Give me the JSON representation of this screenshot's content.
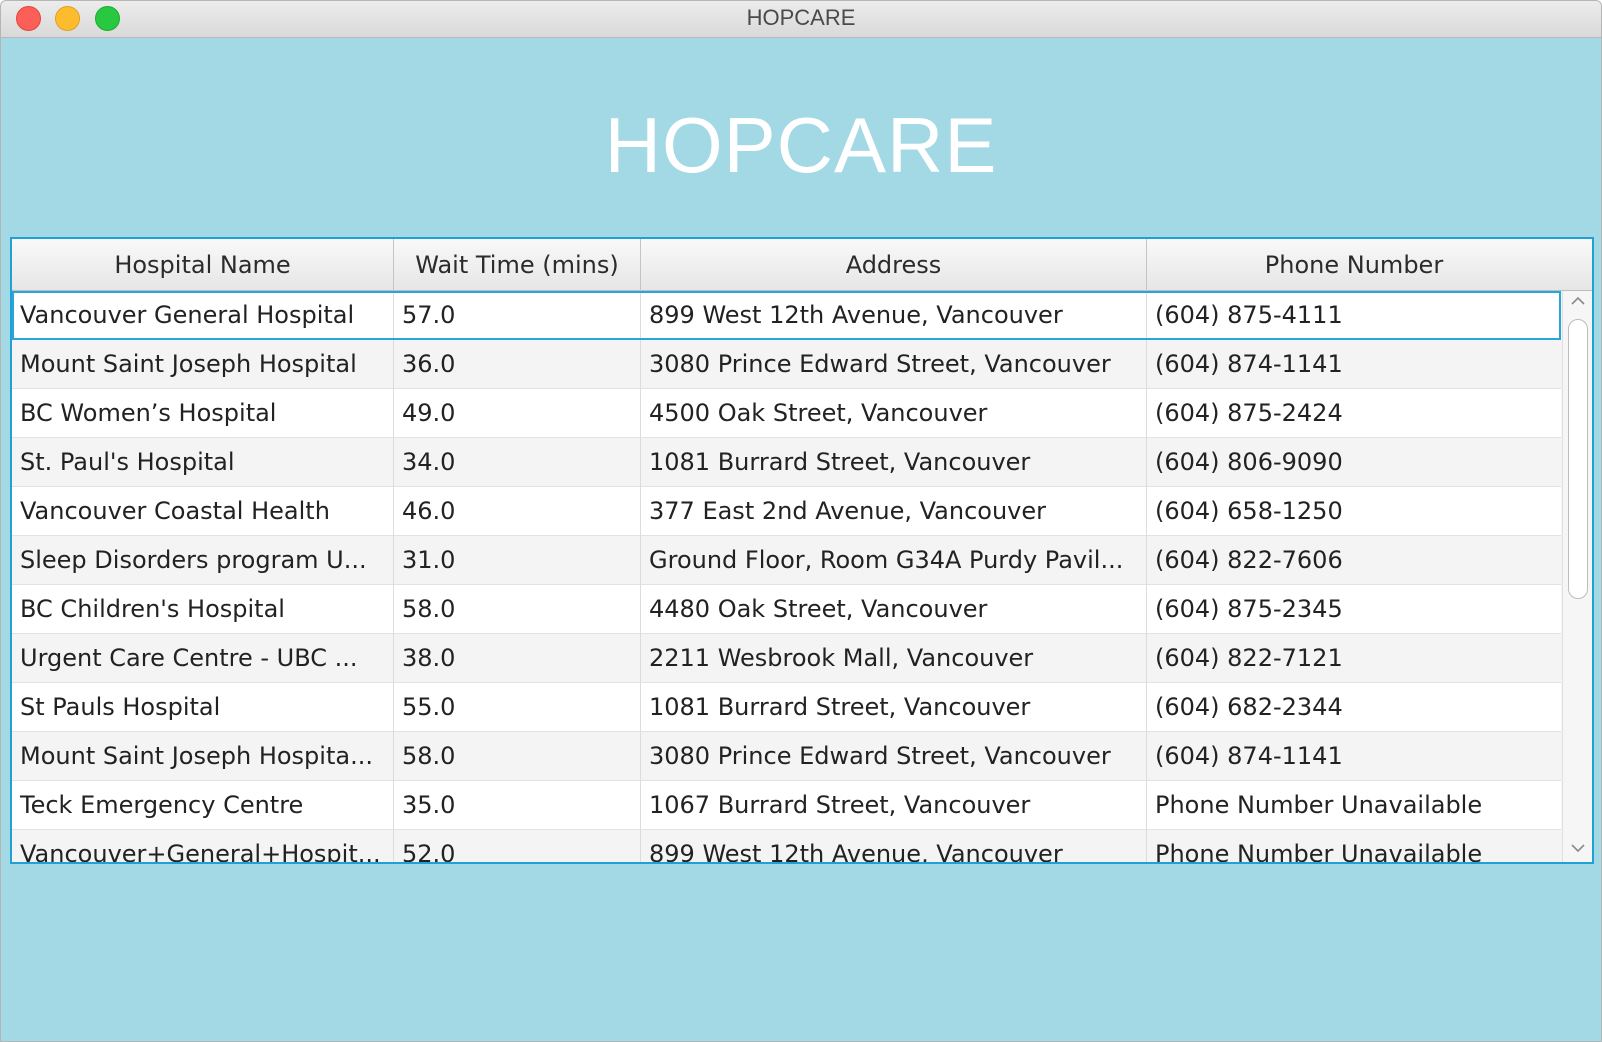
{
  "window": {
    "title": "HOPCARE"
  },
  "app": {
    "heading": "HOPCARE"
  },
  "table": {
    "columns": [
      "Hospital Name",
      "Wait Time (mins)",
      "Address",
      "Phone Number"
    ],
    "rows": [
      [
        "Vancouver General Hospital",
        "57.0",
        "899 West 12th Avenue, Vancouver",
        "(604) 875-4111"
      ],
      [
        "Mount Saint Joseph Hospital",
        "36.0",
        "3080 Prince Edward Street, Vancouver",
        "(604) 874-1141"
      ],
      [
        "BC Women’s Hospital",
        "49.0",
        "4500 Oak Street, Vancouver",
        "(604) 875-2424"
      ],
      [
        "St. Paul's Hospital",
        "34.0",
        "1081 Burrard Street, Vancouver",
        "(604) 806-9090"
      ],
      [
        "Vancouver Coastal Health",
        "46.0",
        "377 East 2nd Avenue, Vancouver",
        "(604) 658-1250"
      ],
      [
        "Sleep Disorders program U...",
        "31.0",
        "Ground Floor, Room G34A Purdy Pavil...",
        "(604) 822-7606"
      ],
      [
        "BC Children's Hospital",
        "58.0",
        "4480 Oak Street, Vancouver",
        "(604) 875-2345"
      ],
      [
        "Urgent Care Centre - UBC ...",
        "38.0",
        "2211 Wesbrook Mall, Vancouver",
        "(604) 822-7121"
      ],
      [
        "St Pauls Hospital",
        "55.0",
        "1081 Burrard Street, Vancouver",
        "(604) 682-2344"
      ],
      [
        "Mount Saint Joseph Hospita...",
        "58.0",
        "3080 Prince Edward Street, Vancouver",
        "(604) 874-1141"
      ],
      [
        "Teck Emergency Centre",
        "35.0",
        "1067 Burrard Street, Vancouver",
        "Phone Number Unavailable"
      ],
      [
        "Vancouver+General+Hospit...",
        "52.0",
        "899 West 12th Avenue, Vancouver",
        "Phone Number Unavailable"
      ]
    ],
    "selected_row": 0
  },
  "colors": {
    "background": "#a3d8e5",
    "accent": "#1fa1d6"
  },
  "icons": {
    "scroll_up": "chevron-up-icon",
    "scroll_down": "chevron-down-icon"
  }
}
